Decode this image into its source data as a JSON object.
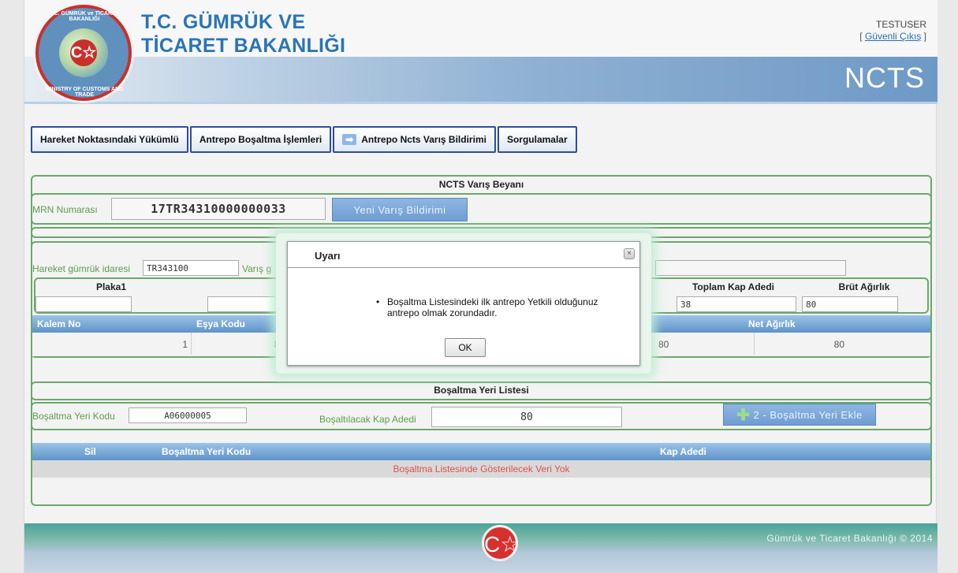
{
  "header": {
    "brand_line1": "T.C. GÜMRÜK VE",
    "brand_line2": "TİCARET BAKANLIĞI",
    "logo_ring_top": "T.C. GÜMRÜK ve TİCARET BAKANLIĞI",
    "logo_ring_bottom": "MINISTRY OF CUSTOMS AND TRADE",
    "logo_symbol": "C☆",
    "user": "TESTUSER",
    "logout_label": "Güvenli Çıkış",
    "app_title": "NCTS"
  },
  "nav": {
    "items": [
      {
        "label": "Hareket Noktasındaki Yükümlü"
      },
      {
        "label": "Antrepo Boşaltma İşlemleri"
      },
      {
        "label": "Antrepo Ncts Varış Bildirimi"
      },
      {
        "label": "Sorgulamalar"
      }
    ]
  },
  "arrival": {
    "title": "NCTS Varış Beyanı",
    "mrn_label": "MRN Numarası",
    "mrn_value": "17TR34310000000033",
    "new_button": "Yeni Varış Bildirimi"
  },
  "details": {
    "departure_office_label": "Hareket gümrük idaresi",
    "departure_office_value": "TR343100",
    "arrival_office_label_partial": "Varış g",
    "plate_label": "Plaka1",
    "total_packages_label": "Toplam Kap Adedi",
    "total_packages_value": "38",
    "gross_weight_label": "Brüt Ağırlık",
    "gross_weight_value": "80"
  },
  "items_grid": {
    "columns": [
      "Kalem No",
      "Eşya Kodu",
      "Net Ağırlık"
    ],
    "row": {
      "kalem_no": "1",
      "esya_kodu_partial": "85",
      "hidden_value": "80",
      "net_agirlik": "80"
    }
  },
  "unloading": {
    "title": "Boşaltma Yeri Listesi",
    "place_code_label": "Boşaltma Yeri Kodu",
    "place_code_value": "A06000005",
    "packages_label": "Boşaltılacak Kap Adedi",
    "packages_value": "80",
    "add_button": "2 - Boşaltma Yeri Ekle",
    "columns": [
      "Sil",
      "Boşaltma Yeri Kodu",
      "Kap Adedi"
    ],
    "empty_message": "Boşaltma Listesinde Gösterilecek Veri Yok"
  },
  "footer": {
    "copyright": "Gümrük ve Ticaret Bakanlığı © 2014",
    "logo_symbol": "C☆"
  },
  "dialog": {
    "title": "Uyarı",
    "close_symbol": "×",
    "message_line1": "Boşaltma Listesindeki ilk antrepo Yetkili olduğunuz",
    "message_line2": "antrepo olmak zorundadır.",
    "ok_label": "OK"
  },
  "icons": {
    "nav_arrow": "arrow-right-icon",
    "add_plus": "plus-icon",
    "close": "close-icon"
  }
}
